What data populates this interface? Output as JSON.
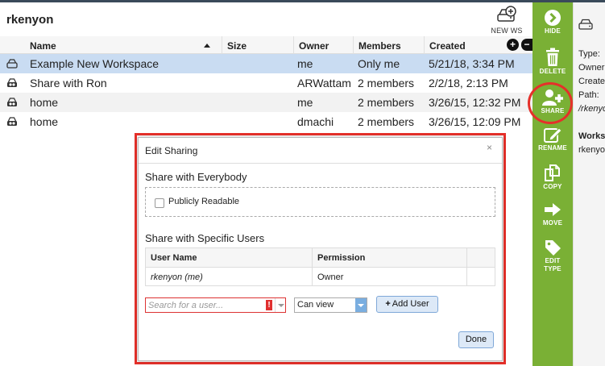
{
  "workspace": {
    "title": "rkenyon"
  },
  "toolbar": {
    "new_ws_label": "NEW WS"
  },
  "grid": {
    "columns": [
      "Name",
      "Size",
      "Owner",
      "Members",
      "Created"
    ],
    "rows": [
      {
        "name": "Example New Workspace",
        "size": "",
        "owner": "me",
        "members": "Only me",
        "created": "5/21/18, 3:34 PM",
        "icon": "workspace-icon",
        "selected": true
      },
      {
        "name": "Share with Ron",
        "size": "",
        "owner": "ARWattam",
        "members": "2 members",
        "created": "2/2/18, 2:13 PM",
        "icon": "shared-workspace-icon"
      },
      {
        "name": "home",
        "size": "",
        "owner": "me",
        "members": "2 members",
        "created": "3/26/15, 12:32 PM",
        "icon": "shared-workspace-icon"
      },
      {
        "name": "home",
        "size": "",
        "owner": "dmachi",
        "members": "2 members",
        "created": "3/26/15, 12:09 PM",
        "icon": "shared-workspace-icon"
      }
    ]
  },
  "actions": [
    {
      "label": "HIDE",
      "icon": "chevron-right-icon"
    },
    {
      "label": "DELETE",
      "icon": "trash-icon"
    },
    {
      "label": "SHARE",
      "icon": "add-user-icon"
    },
    {
      "label": "RENAME",
      "icon": "pencil-icon"
    },
    {
      "label": "COPY",
      "icon": "copy-icon"
    },
    {
      "label": "MOVE",
      "icon": "arrow-right-icon"
    },
    {
      "label": "EDIT",
      "label2": "TYPE",
      "icon": "tag-icon"
    }
  ],
  "info_panel": {
    "type_label": "Type: ",
    "owner_label": "Owner",
    "created_label": "Create",
    "path_label": "Path:",
    "path_value": "/rkenyo",
    "section_label": "Worksp",
    "section_value": "rkenyo"
  },
  "dialog": {
    "title": "Edit Sharing",
    "close": "×",
    "everybody_title": "Share with Everybody",
    "publicly_readable_label": "Publicly Readable",
    "specific_title": "Share with Specific Users",
    "table_headers": [
      "User Name",
      "Permission"
    ],
    "users": [
      {
        "name": "rkenyon (me)",
        "permission": "Owner"
      }
    ],
    "search_placeholder": "Search for a user...",
    "error_mark": "!",
    "permission_value": "Can view",
    "add_user_label": "Add User",
    "done_label": "Done"
  },
  "colors": {
    "action_bar": "#7ab035",
    "highlight": "#e5302a",
    "selected_row": "#c9dcf2"
  }
}
